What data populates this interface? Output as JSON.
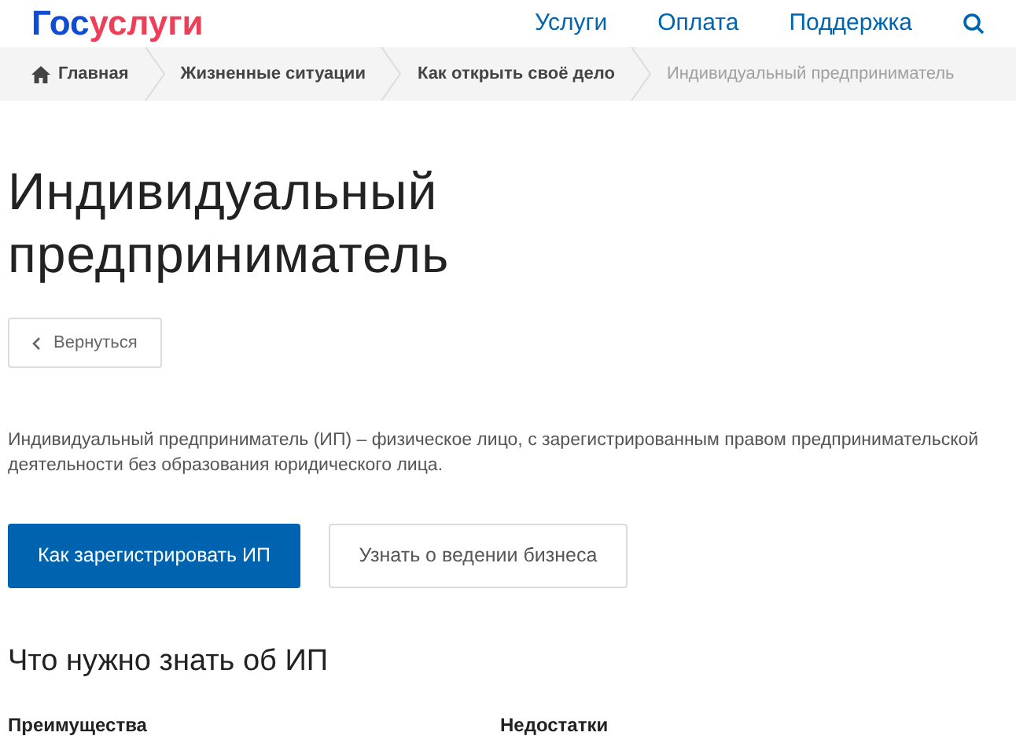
{
  "logo": {
    "first": "Гос",
    "second": "услуги"
  },
  "nav": [
    "Услуги",
    "Оплата",
    "Поддержка"
  ],
  "breadcrumbs": [
    {
      "label": "Главная",
      "kind": "home"
    },
    {
      "label": "Жизненные ситуации",
      "kind": "link"
    },
    {
      "label": "Как открыть своё дело",
      "kind": "link"
    },
    {
      "label": "Индивидуальный предприниматель",
      "kind": "current"
    }
  ],
  "title": "Индивидуальный предприниматель",
  "back_button": "Вернуться",
  "description": "Индивидуальный предприниматель (ИП) – физическое лицо, с зарегистрированным правом предпринимательской деятельности без образования юридического лица.",
  "actions": [
    {
      "label": "Как зарегистрировать ИП",
      "kind": "primary"
    },
    {
      "label": "Узнать о ведении бизнеса",
      "kind": "secondary"
    }
  ],
  "section_title": "Что нужно знать об ИП",
  "columns": [
    "Преимущества",
    "Недостатки"
  ]
}
